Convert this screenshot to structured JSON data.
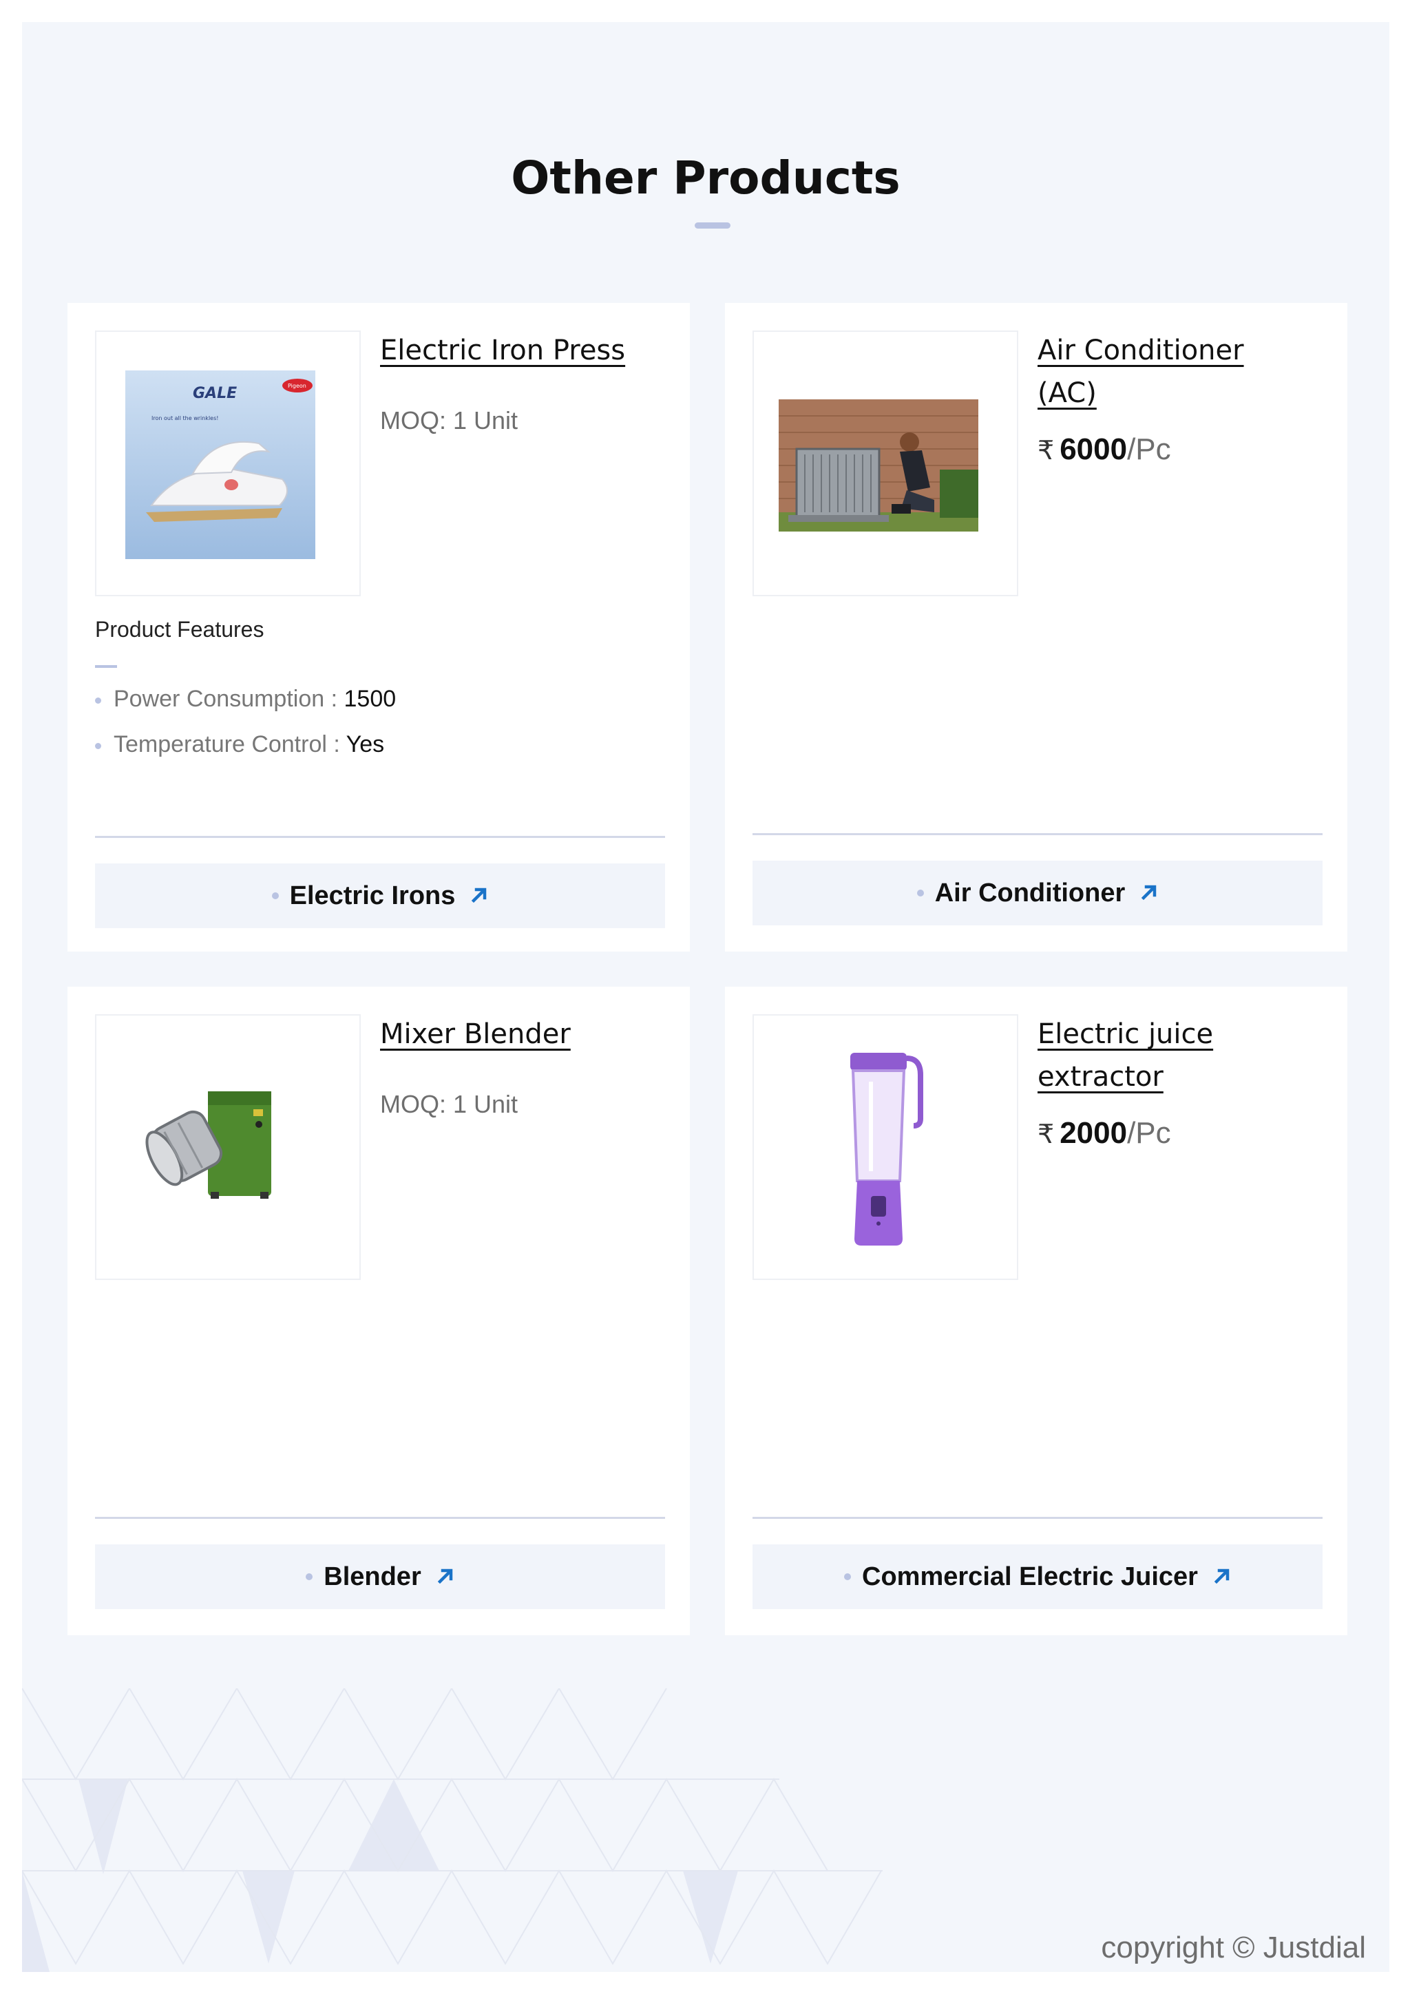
{
  "section": {
    "title": "Other Products"
  },
  "products": [
    {
      "name": "Electric Iron Press",
      "moq": "MOQ: 1 Unit",
      "image_icon": "electric-iron-image",
      "image_text": {
        "brand": "GALE",
        "logo": "Pigeon",
        "tagline": "Iron out all the wrinkles!"
      },
      "features_title": "Product Features",
      "features": [
        {
          "label": "Power Consumption : ",
          "value": "1500"
        },
        {
          "label": "Temperature Control : ",
          "value": "Yes"
        }
      ],
      "category": "Electric Irons"
    },
    {
      "name": "Air Conditioner (AC)",
      "price": {
        "currency": "₹",
        "amount": "6000",
        "unit": "/Pc"
      },
      "image_icon": "air-conditioner-unit-image",
      "category": "Air Conditioner"
    },
    {
      "name": "Mixer Blender",
      "moq": "MOQ: 1 Unit",
      "image_icon": "mixer-blender-image",
      "category": "Blender"
    },
    {
      "name": "Electric juice extractor",
      "price": {
        "currency": "₹",
        "amount": "2000",
        "unit": "/Pc"
      },
      "image_icon": "portable-juicer-image",
      "category": "Commercial Electric Juicer"
    }
  ],
  "link_icon": "↗",
  "footer": {
    "copyright": "copyright © Justdial"
  },
  "colors": {
    "background": "#f3f6fb",
    "accent": "#1a73c8",
    "divider": "#d3d8e8",
    "dot": "#b9c3e2"
  }
}
